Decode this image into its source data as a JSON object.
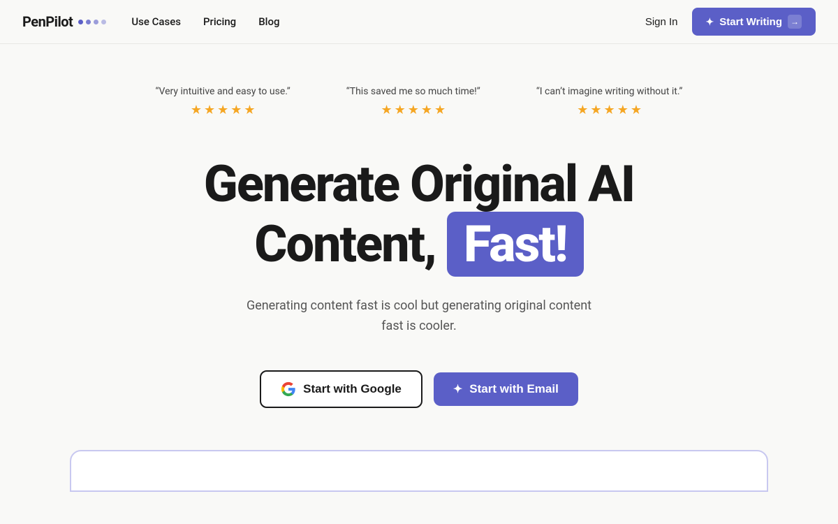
{
  "navbar": {
    "logo_text": "PenPilot",
    "nav_links": [
      {
        "label": "Use Cases",
        "id": "use-cases"
      },
      {
        "label": "Pricing",
        "id": "pricing"
      },
      {
        "label": "Blog",
        "id": "blog"
      }
    ],
    "sign_in_label": "Sign In",
    "start_writing_label": "Start Writing"
  },
  "testimonials": [
    {
      "text": "“Very intuitive and easy to use.”",
      "stars": 5
    },
    {
      "text": "“This saved me so much time!”",
      "stars": 5
    },
    {
      "text": "“I can’t imagine writing without it.”",
      "stars": 5
    }
  ],
  "hero": {
    "title_line1": "Generate Original AI",
    "title_line2_prefix": "Content,",
    "title_fast": "Fast!",
    "subtitle": "Generating content fast is cool but generating original content fast is cooler."
  },
  "cta": {
    "google_label": "Start with Google",
    "email_label": "Start with Email"
  },
  "colors": {
    "accent": "#5b5fc7",
    "star": "#f5a623"
  }
}
